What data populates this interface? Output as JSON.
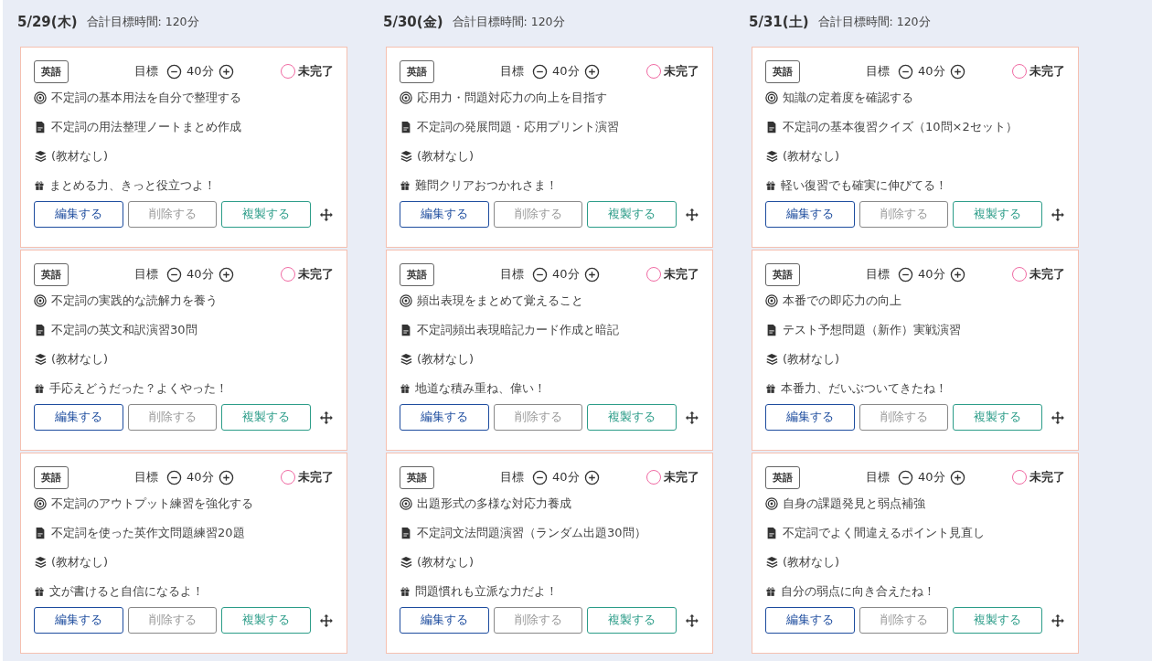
{
  "days": [
    {
      "date": "5/29(木)",
      "total": "合計目標時間: 120分",
      "cards": [
        {
          "subject": "英語",
          "target_label": "目標",
          "minutes": "40分",
          "status": "未完了",
          "completed": false,
          "goal": "不定詞の基本用法を自分で整理する",
          "task": "不定詞の用法整理ノートまとめ作成",
          "material": "(教材なし)",
          "message": "まとめる力、きっと役立つよ！",
          "buttons": [
            {
              "label": "編集する",
              "kind": "edit"
            },
            {
              "label": "削除する",
              "kind": "delete"
            },
            {
              "label": "複製する",
              "kind": "copy"
            }
          ]
        },
        {
          "subject": "英語",
          "target_label": "目標",
          "minutes": "40分",
          "status": "未完了",
          "completed": false,
          "goal": "不定詞の実践的な読解力を養う",
          "task": "不定詞の英文和訳演習30問",
          "material": "(教材なし)",
          "message": "手応えどうだった？よくやった！",
          "buttons": [
            {
              "label": "編集する",
              "kind": "edit"
            },
            {
              "label": "削除する",
              "kind": "delete"
            },
            {
              "label": "複製する",
              "kind": "copy"
            }
          ]
        },
        {
          "subject": "英語",
          "target_label": "目標",
          "minutes": "40分",
          "status": "未完了",
          "completed": false,
          "goal": "不定詞のアウトプット練習を強化する",
          "task": "不定詞を使った英作文問題練習20題",
          "material": "(教材なし)",
          "message": "文が書けると自信になるよ！",
          "buttons": [
            {
              "label": "編集する",
              "kind": "edit"
            },
            {
              "label": "削除する",
              "kind": "delete"
            },
            {
              "label": "複製する",
              "kind": "copy"
            }
          ]
        }
      ]
    },
    {
      "date": "5/30(金)",
      "total": "合計目標時間: 120分",
      "cards": [
        {
          "subject": "英語",
          "target_label": "目標",
          "minutes": "40分",
          "status": "未完了",
          "completed": false,
          "goal": "応用力・問題対応力の向上を目指す",
          "task": "不定詞の発展問題・応用プリント演習",
          "material": "(教材なし)",
          "message": "難問クリアおつかれさま！",
          "buttons": [
            {
              "label": "編集する",
              "kind": "edit"
            },
            {
              "label": "削除する",
              "kind": "delete"
            },
            {
              "label": "複製する",
              "kind": "copy"
            }
          ]
        },
        {
          "subject": "英語",
          "target_label": "目標",
          "minutes": "40分",
          "status": "未完了",
          "completed": false,
          "goal": "頻出表現をまとめて覚えること",
          "task": "不定詞頻出表現暗記カード作成と暗記",
          "material": "(教材なし)",
          "message": "地道な積み重ね、偉い！",
          "buttons": [
            {
              "label": "編集する",
              "kind": "edit"
            },
            {
              "label": "削除する",
              "kind": "delete"
            },
            {
              "label": "複製する",
              "kind": "copy"
            }
          ]
        },
        {
          "subject": "英語",
          "target_label": "目標",
          "minutes": "40分",
          "status": "未完了",
          "completed": false,
          "goal": "出題形式の多様な対応力養成",
          "task": "不定詞文法問題演習（ランダム出題30問）",
          "material": "(教材なし)",
          "message": "問題慣れも立派な力だよ！",
          "buttons": [
            {
              "label": "編集する",
              "kind": "edit"
            },
            {
              "label": "削除する",
              "kind": "delete"
            },
            {
              "label": "複製する",
              "kind": "copy"
            }
          ]
        }
      ]
    },
    {
      "date": "5/31(土)",
      "total": "合計目標時間: 120分",
      "cards": [
        {
          "subject": "英語",
          "target_label": "目標",
          "minutes": "40分",
          "status": "未完了",
          "completed": false,
          "goal": "知識の定着度を確認する",
          "task": "不定詞の基本復習クイズ（10問×2セット）",
          "material": "(教材なし)",
          "message": "軽い復習でも確実に伸びてる！",
          "buttons": [
            {
              "label": "編集する",
              "kind": "edit"
            },
            {
              "label": "削除する",
              "kind": "delete"
            },
            {
              "label": "複製する",
              "kind": "copy"
            }
          ]
        },
        {
          "subject": "英語",
          "target_label": "目標",
          "minutes": "40分",
          "status": "未完了",
          "completed": false,
          "goal": "本番での即応力の向上",
          "task": "テスト予想問題（新作）実戦演習",
          "material": "(教材なし)",
          "message": "本番力、だいぶついてきたね！",
          "buttons": [
            {
              "label": "編集する",
              "kind": "edit"
            },
            {
              "label": "削除する",
              "kind": "delete"
            },
            {
              "label": "複製する",
              "kind": "copy"
            }
          ]
        },
        {
          "subject": "英語",
          "target_label": "目標",
          "minutes": "40分",
          "status": "未完了",
          "completed": false,
          "goal": "自身の課題発見と弱点補強",
          "task": "不定詞でよく間違えるポイント見直し",
          "material": "(教材なし)",
          "message": "自分の弱点に向き合えたね！",
          "buttons": [
            {
              "label": "編集する",
              "kind": "edit"
            },
            {
              "label": "削除する",
              "kind": "delete"
            },
            {
              "label": "複製する",
              "kind": "copy"
            }
          ]
        }
      ]
    }
  ]
}
